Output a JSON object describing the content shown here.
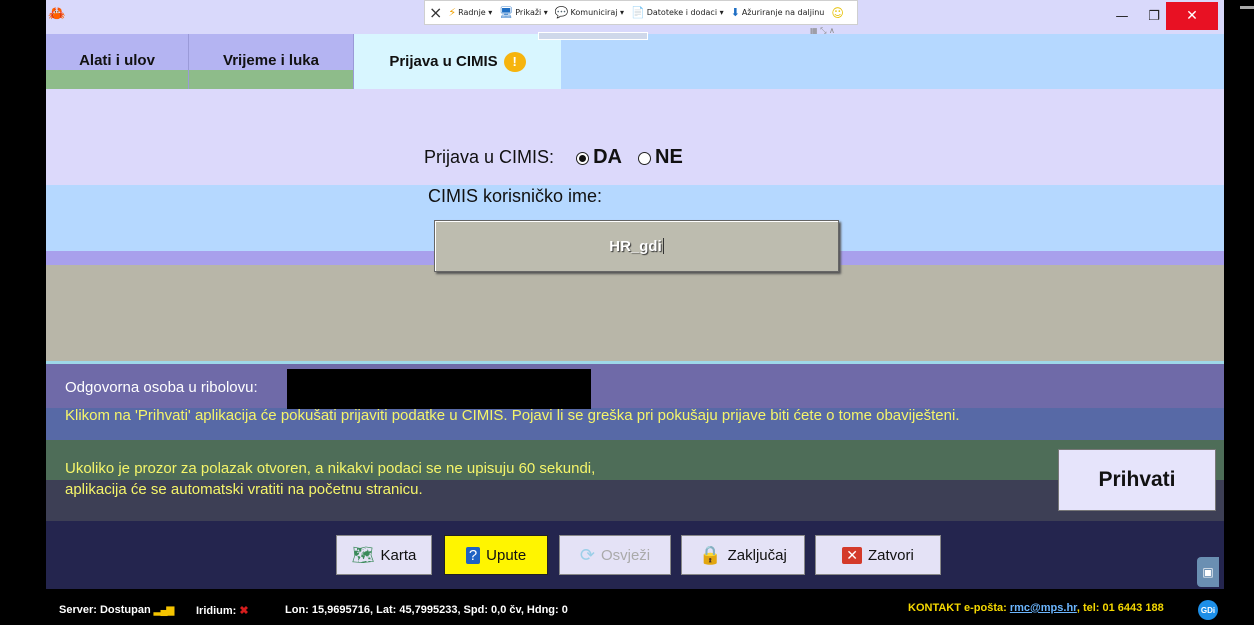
{
  "colors": {
    "accent_yellow": "#f5f56a",
    "close_red": "#e81123",
    "tab_active": "#d8f6ff",
    "lavender": "#dcd9fb"
  },
  "titlebar": {
    "app_icon": "crab-icon",
    "remote_toolbar": {
      "close": "×",
      "menus": [
        "Radnje",
        "Prikaži",
        "Komuniciraj",
        "Datoteke i dodaci",
        "Ažuriranje na daljinu"
      ]
    },
    "minimize": "—",
    "restore": "❐",
    "close": "✕"
  },
  "tabs": [
    {
      "label": "Alati i ulov"
    },
    {
      "label": "Vrijeme i luka"
    },
    {
      "label": "Prijava u CIMIS",
      "active": true,
      "icon": "warning-icon"
    }
  ],
  "form": {
    "prijava_label": "Prijava u CIMIS:",
    "option_yes": "DA",
    "option_no": "NE",
    "selected": "DA",
    "username_label": "CIMIS korisničko ime:",
    "username_value": "HR_gdi"
  },
  "info": {
    "responsible_label": "Odgovorna osoba u ribolovu:",
    "notice": "Klikom na 'Prihvati' aplikacija će pokušati prijaviti podatke u CIMIS. Pojavi li se greška pri pokušaju prijave biti ćete o tome obaviješteni.",
    "timeout_line1": "Ukoliko je prozor za polazak otvoren, a nikakvi podaci se ne upisuju 60 sekundi,",
    "timeout_line2": "aplikacija će se automatski vratiti na početnu stranicu.",
    "accept_label": "Prihvati"
  },
  "toolbar": {
    "karta": "Karta",
    "upute": "Upute",
    "osvjezi": "Osvježi",
    "zakljucaj": "Zaključaj",
    "zatvori": "Zatvori"
  },
  "status": {
    "server": "Server: Dostupan",
    "iridium": "Iridium:",
    "position": "Lon: 15,9695716, Lat: 45,7995233, Spd: 0,0 čv, Hdng: 0",
    "contact_prefix": "KONTAKT e-pošta:",
    "contact_email": "rmc@mps.hr",
    "contact_phone": ", tel: 01 6443 188",
    "logo": "GDi"
  }
}
